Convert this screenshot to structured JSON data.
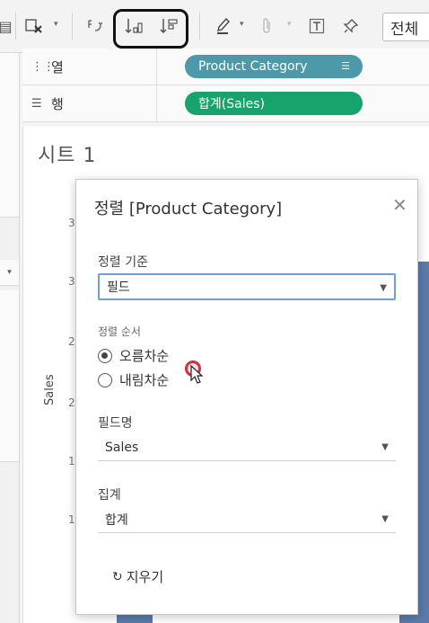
{
  "toolbar": {
    "view_button_label": "전체",
    "icons": [
      "clear-sheet-icon",
      "swap-icon",
      "sort-ascending-icon",
      "sort-descending-icon",
      "highlight-icon",
      "attach-icon",
      "text-label-icon",
      "pin-icon"
    ]
  },
  "shelves": {
    "columns": {
      "label": "열",
      "pill": "Product Category",
      "pill_color": "#4c9aa9"
    },
    "rows": {
      "label": "행",
      "pill": "합계(Sales)",
      "pill_color": "#17a36b"
    }
  },
  "sheet": {
    "title": "시트 1",
    "y_axis_label": "Sales",
    "ticks": [
      "3",
      "3",
      "2",
      "2",
      "1",
      "1"
    ]
  },
  "sort_dialog": {
    "title": "정렬 [Product Category]",
    "sort_by_label": "정렬 기준",
    "sort_by_value": "필드",
    "sort_order_label": "정렬 순서",
    "ascending_label": "오름차순",
    "descending_label": "내림차순",
    "selected_order": "ascending",
    "field_name_label": "필드명",
    "field_name_value": "Sales",
    "aggregation_label": "집계",
    "aggregation_value": "합계",
    "clear_label": "지우기"
  },
  "colors": {
    "bar": "#5a7aa8",
    "focus_border": "#6f9fd8"
  }
}
